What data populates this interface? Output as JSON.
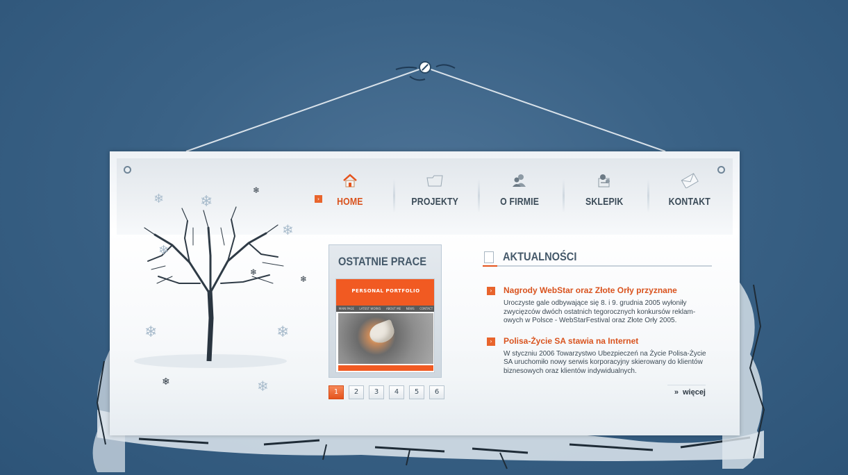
{
  "nav": {
    "items": [
      {
        "label": "HOME",
        "icon": "home-icon"
      },
      {
        "label": "PROJEKTY",
        "icon": "folder-icon"
      },
      {
        "label": "O FIRMIE",
        "icon": "people-icon"
      },
      {
        "label": "SKLEPIK",
        "icon": "shop-icon"
      },
      {
        "label": "KONTAKT",
        "icon": "envelope-icon"
      }
    ],
    "active": "HOME"
  },
  "works": {
    "title": "OSTATNIE PRACE",
    "thumbnail": {
      "logo": "PERSONAL PORTFOLIO",
      "nav": [
        "MAIN PAGE",
        "LATEST WORKS",
        "ABOUT ME",
        "NEWS",
        "CONTACT"
      ]
    },
    "pages": [
      "1",
      "2",
      "3",
      "4",
      "5",
      "6"
    ],
    "current_page": "1"
  },
  "news": {
    "title": "AKTUALNOŚCI",
    "items": [
      {
        "heading": "Nagrody WebStar oraz Złote Orły przyznane",
        "body": "Uroczyste gale odbywające się 8. i 9. grudnia 2005 wyłoniły zwycięzców dwóch ostatnich tegorocznych konkursów reklam- owych w Polsce - WebStarFestival oraz Złote Orły 2005."
      },
      {
        "heading": "Polisa-Życie SA stawia na Internet",
        "body": "W styczniu 2006 Towarzystwo Ubezpieczeń na Życie Polisa-Życie SA uruchomiło nowy serwis korporacyjny skierowany do klientów biznesowych oraz klientów indywidualnych."
      }
    ],
    "more_label": "więcej",
    "more_arrow": "»"
  },
  "colors": {
    "accent": "#e5531c",
    "background": "#3a6286",
    "text": "#3c4a55"
  }
}
